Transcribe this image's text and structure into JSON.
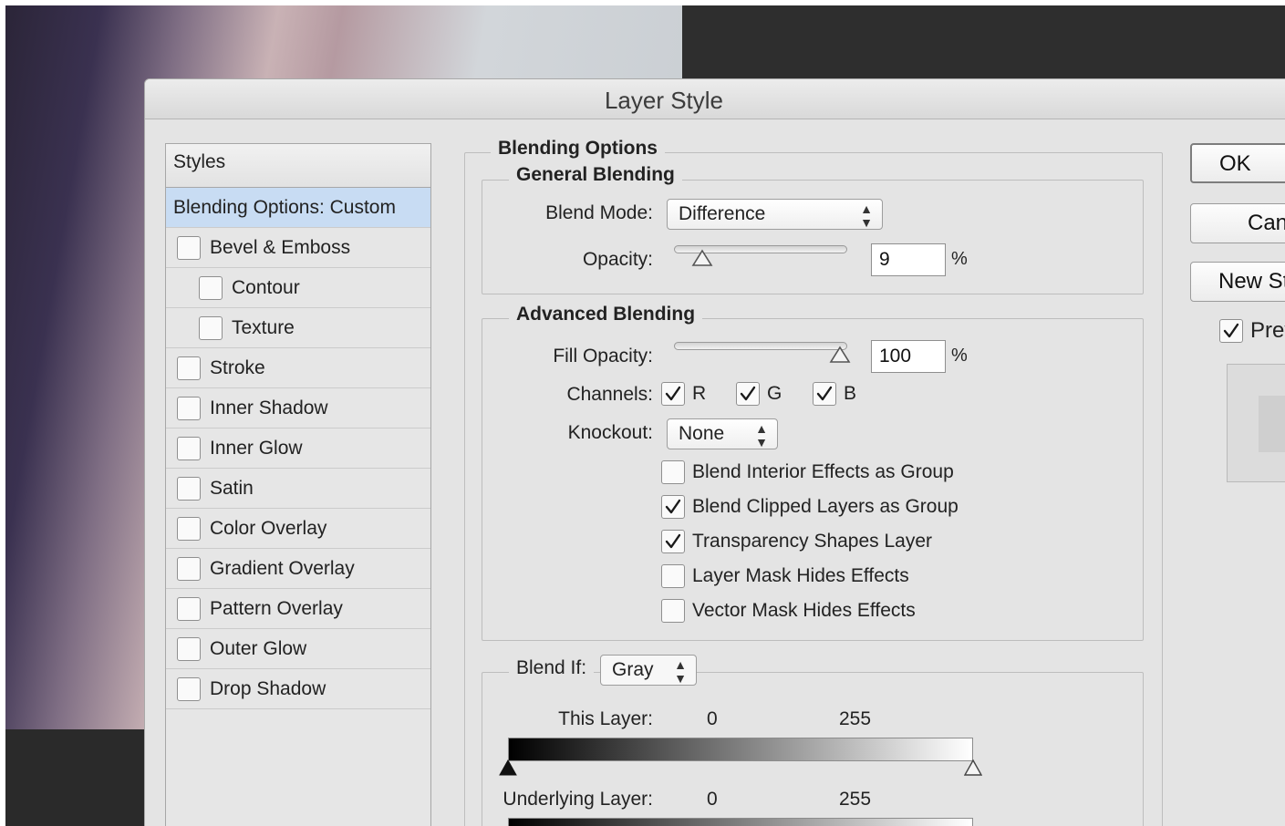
{
  "dialog": {
    "title": "Layer Style"
  },
  "styles": {
    "header": "Styles",
    "items": [
      {
        "label": "Blending Options: Custom",
        "selected": true,
        "checkbox": false,
        "sub": false
      },
      {
        "label": "Bevel & Emboss",
        "checked": false,
        "checkbox": true,
        "sub": false
      },
      {
        "label": "Contour",
        "checked": false,
        "checkbox": true,
        "sub": true
      },
      {
        "label": "Texture",
        "checked": false,
        "checkbox": true,
        "sub": true
      },
      {
        "label": "Stroke",
        "checked": false,
        "checkbox": true,
        "sub": false
      },
      {
        "label": "Inner Shadow",
        "checked": false,
        "checkbox": true,
        "sub": false
      },
      {
        "label": "Inner Glow",
        "checked": false,
        "checkbox": true,
        "sub": false
      },
      {
        "label": "Satin",
        "checked": false,
        "checkbox": true,
        "sub": false
      },
      {
        "label": "Color Overlay",
        "checked": false,
        "checkbox": true,
        "sub": false
      },
      {
        "label": "Gradient Overlay",
        "checked": false,
        "checkbox": true,
        "sub": false
      },
      {
        "label": "Pattern Overlay",
        "checked": false,
        "checkbox": true,
        "sub": false
      },
      {
        "label": "Outer Glow",
        "checked": false,
        "checkbox": true,
        "sub": false
      },
      {
        "label": "Drop Shadow",
        "checked": false,
        "checkbox": true,
        "sub": false
      }
    ]
  },
  "blending": {
    "title": "Blending Options",
    "general": {
      "title": "General Blending",
      "blend_mode_label": "Blend Mode:",
      "blend_mode_value": "Difference",
      "opacity_label": "Opacity:",
      "opacity_value": "9",
      "opacity_unit": "%",
      "opacity_fraction": 0.09
    },
    "advanced": {
      "title": "Advanced Blending",
      "fill_opacity_label": "Fill Opacity:",
      "fill_opacity_value": "100",
      "fill_opacity_unit": "%",
      "fill_opacity_fraction": 1.0,
      "channels_label": "Channels:",
      "channels": [
        {
          "label": "R",
          "checked": true
        },
        {
          "label": "G",
          "checked": true
        },
        {
          "label": "B",
          "checked": true
        }
      ],
      "knockout_label": "Knockout:",
      "knockout_value": "None",
      "options": [
        {
          "label": "Blend Interior Effects as Group",
          "checked": false
        },
        {
          "label": "Blend Clipped Layers as Group",
          "checked": true
        },
        {
          "label": "Transparency Shapes Layer",
          "checked": true
        },
        {
          "label": "Layer Mask Hides Effects",
          "checked": false
        },
        {
          "label": "Vector Mask Hides Effects",
          "checked": false
        }
      ]
    },
    "blend_if": {
      "label": "Blend If:",
      "value": "Gray",
      "this_layer_label": "This Layer:",
      "this_layer_min": "0",
      "this_layer_max": "255",
      "underlying_label": "Underlying Layer:",
      "underlying_min": "0",
      "underlying_max": "255"
    }
  },
  "buttons": {
    "ok": "OK",
    "cancel": "Cancel",
    "new_style": "New Style...",
    "preview_label": "Preview",
    "preview_checked": true
  }
}
